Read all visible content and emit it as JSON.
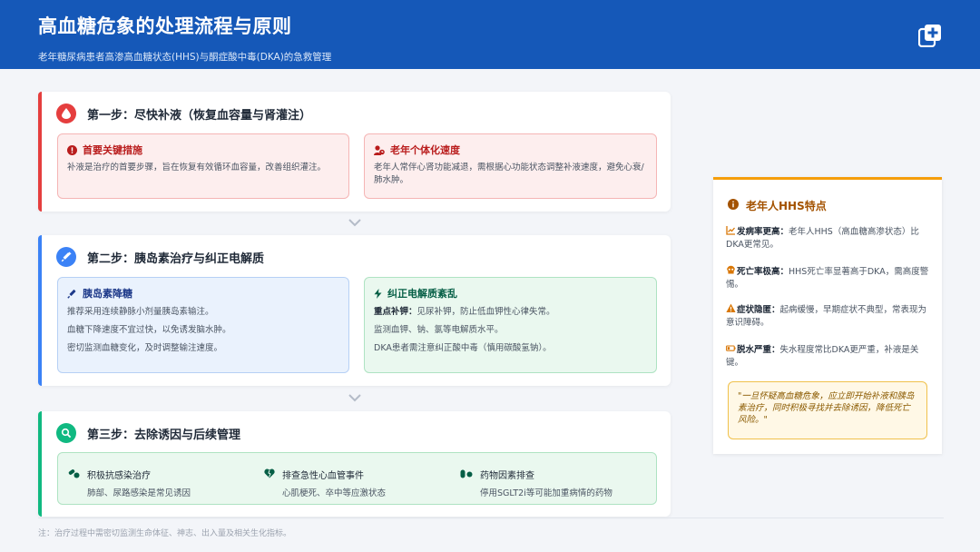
{
  "header": {
    "title": "高血糖危象的处理流程与原则",
    "subtitle": "老年糖尿病患者高渗高血糖状态(HHS)与酮症酸中毒(DKA)的急救管理",
    "icon": "medical-plus-icon"
  },
  "step1": {
    "title": "第一步：尽快补液（恢复血容量与肾灌注）",
    "color": "#e53e3e",
    "box1": {
      "title": "首要关键措施",
      "text": "补液是治疗的首要步骤，旨在恢复有效循环血容量，改善组织灌注。"
    },
    "box2": {
      "title": "老年个体化速度",
      "text": "老年人常伴心肾功能减退，需根据心功能状态调整补液速度，避免心衰/肺水肿。"
    }
  },
  "step2": {
    "title": "第二步：胰岛素治疗与纠正电解质",
    "color": "#3b82f6",
    "box1": {
      "title": "胰岛素降糖",
      "lines": [
        "推荐采用连续静脉小剂量胰岛素输注。",
        "血糖下降速度不宜过快，以免诱发脑水肿。",
        "密切监测血糖变化，及时调整输注速度。"
      ]
    },
    "box2": {
      "title": "纠正电解质紊乱",
      "lead": "重点补钾：",
      "line1_rest": "见尿补钾，防止低血钾性心律失常。",
      "line2": "监测血钾、钠、氯等电解质水平。",
      "line3": "DKA患者需注意纠正酸中毒（慎用碳酸氢钠）。"
    }
  },
  "step3": {
    "title": "第三步：去除诱因与后续管理",
    "color": "#10b981",
    "items": [
      {
        "title": "积极抗感染治疗",
        "desc": "肺部、尿路感染是常见诱因",
        "icon": "pills-icon"
      },
      {
        "title": "排查急性心血管事件",
        "desc": "心肌梗死、卒中等应激状态",
        "icon": "heart-broken-icon"
      },
      {
        "title": "药物因素排查",
        "desc": "停用SGLT2i等可能加重病情的药物",
        "icon": "capsules-icon"
      }
    ]
  },
  "sidebar": {
    "title": "老年人HHS特点",
    "features": [
      {
        "label": "发病率更高：",
        "text": "老年人HHS（高血糖高渗状态）比DKA更常见。",
        "icon": "chart-line-icon"
      },
      {
        "label": "死亡率极高：",
        "text": "HHS死亡率显著高于DKA，需高度警惕。",
        "icon": "skull-icon"
      },
      {
        "label": "症状隐匿：",
        "text": "起病缓慢，早期症状不典型，常表现为意识障碍。",
        "icon": "warning-icon"
      },
      {
        "label": "脱水严重：",
        "text": "失水程度常比DKA更严重，补液是关键。",
        "icon": "battery-low-icon"
      }
    ],
    "quote": "\"一旦怀疑高血糖危象，应立即开始补液和胰岛素治疗，同时积极寻找并去除诱因，降低死亡风险。\""
  },
  "footnote": "注：治疗过程中需密切监测生命体征、神志、出入量及相关生化指标。"
}
